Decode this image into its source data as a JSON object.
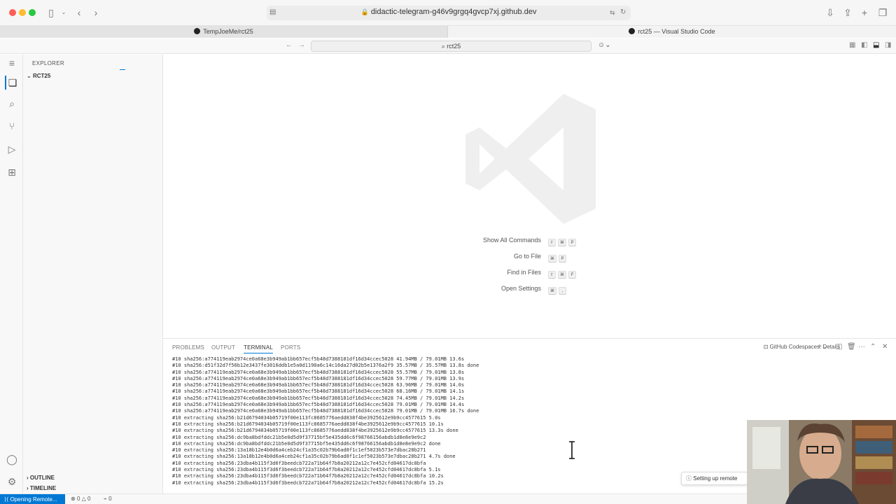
{
  "browser": {
    "url": "didactic-telegram-g46v9grgq4gvcp7xj.github.dev",
    "tabs": [
      {
        "label": "TempJoeMe/rct25"
      },
      {
        "label": "rct25 — Visual Studio Code"
      }
    ]
  },
  "vscode": {
    "command_center": "rct25",
    "explorer": {
      "title": "EXPLORER",
      "root": "RCT25",
      "sections": [
        "OUTLINE",
        "TIMELINE"
      ]
    },
    "welcome": {
      "shortcuts": [
        {
          "label": "Show All Commands",
          "keys": [
            "⇧",
            "⌘",
            "P"
          ]
        },
        {
          "label": "Go to File",
          "keys": [
            "⌘",
            "P"
          ]
        },
        {
          "label": "Find in Files",
          "keys": [
            "⇧",
            "⌘",
            "F"
          ]
        },
        {
          "label": "Open Settings",
          "keys": [
            "⌘",
            ","
          ]
        }
      ]
    },
    "panel": {
      "tabs": [
        "PROBLEMS",
        "OUTPUT",
        "TERMINAL",
        "PORTS"
      ],
      "active_tab": "TERMINAL",
      "terminal_name": "GitHub Codespaces: Details",
      "terminal_lines": [
        "#10 sha256:a774119eab2974ce0a68e3b949ab1bb657ecf5b48d7388181df16d34ccec5028 41.94MB / 79.01MB 13.6s",
        "#10 sha256:d51f32d7f56b12e3437fe3016ddb1e5a0d1190a6c14c16da27d02b5e1376a2f9 35.57MB / 35.57MB 13.8s done",
        "#10 sha256:a774119eab2974ce0a68e3b949ab1bb657ecf5b48d7388181df16d34ccec5028 55.57MB / 79.01MB 13.8s",
        "#10 sha256:a774119eab2974ce0a68e3b949ab1bb657ecf5b48d7388181df16d34ccec5028 59.77MB / 79.01MB 13.9s",
        "#10 sha256:a774119eab2974ce0a68e3b949ab1bb657ecf5b48d7388181df16d34ccec5028 63.96MB / 79.01MB 14.0s",
        "#10 sha256:a774119eab2974ce0a68e3b949ab1bb657ecf5b48d7388181df16d34ccec5028 68.16MB / 79.01MB 14.1s",
        "#10 sha256:a774119eab2974ce0a68e3b949ab1bb657ecf5b48d7388181df16d34ccec5028 74.45MB / 79.01MB 14.2s",
        "#10 sha256:a774119eab2974ce0a68e3b949ab1bb657ecf5b48d7388181df16d34ccec5028 79.01MB / 79.01MB 14.4s",
        "#10 sha256:a774119eab2974ce0a68e3b949ab1bb657ecf5b48d7388181df16d34ccec5028 79.01MB / 79.01MB 16.7s done",
        "#10 extracting sha256:b21d6794034b05719f00e113fc8685776aedd838f4be3925612e9b9cc4577615 5.0s",
        "#10 extracting sha256:b21d6794034b05719f00e113fc8685776aedd838f4be3925612e9b9cc4577615 10.1s",
        "#10 extracting sha256:b21d6794034b05719f00e113fc8685776aedd838f4be3925612e9b9cc4577615 13.3s done",
        "#10 extracting sha256:dc9ba8bdfddc21b5e0d5d9f37715bf5e435dd6c6f98766156abdb1d8e8e9e9c2",
        "#10 extracting sha256:dc9ba8bdfddc21b5e0d5d9f37715bf5e435dd6c6f98766156abdb1d8e8e9e9c2 done",
        "#10 extracting sha256:13a18b12e4b0d6a4ceb24cf1a35c02b79b6ad8f1c1ef5023b573e7dbac28b271",
        "#10 extracting sha256:13a18b12e4b0d6a4ceb24cf1a35c02b79b6ad8f1c1ef5023b573e7dbac28b271 4.7s done",
        "#10 extracting sha256:23dba4b115f3d6f3beedcb722a71b64f7b8a20212a12c7e452cfd04617dc8bfa",
        "#10 extracting sha256:23dba4b115f3d6f3beedcb722a71b64f7b8a20212a12c7e452cfd04617dc8bfa 5.1s",
        "#10 extracting sha256:23dba4b115f3d6f3beedcb722a71b64f7b8a20212a12c7e452cfd04617dc8bfa 10.2s",
        "#10 extracting sha256:23dba4b115f3d6f3beedcb722a71b64f7b8a20212a12c7e452cfd04617dc8bfa 15.2s"
      ]
    },
    "status_bar": {
      "remote": "Opening Remote...",
      "errors": "0",
      "warnings": "0",
      "ports": "0"
    },
    "notification": "Setting up remote"
  },
  "colors": {
    "accent": "#0078d4"
  }
}
